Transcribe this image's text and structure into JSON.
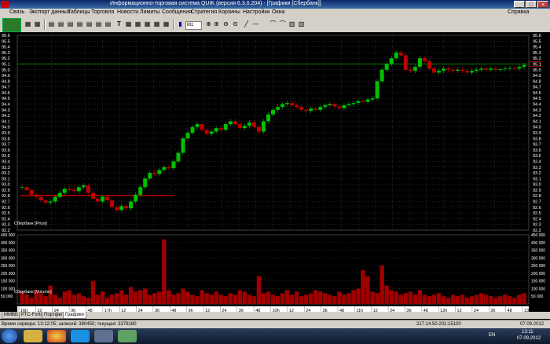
{
  "window": {
    "title": "Информационно-торговая система QUIK (версия 6.3.0.204) - [Графики [Сбербанк]]"
  },
  "menu": [
    "Связь",
    "Экспорт данных",
    "Таблицы",
    "Торговля",
    "Новости",
    "Лимиты",
    "Сообщения",
    "Стратегия",
    "Корзины",
    "Настройки",
    "Окна"
  ],
  "help_label": "Справка",
  "toolbar": {
    "interval": "M1"
  },
  "price_axis": [
    "95.6",
    "95.5",
    "95.4",
    "95.3",
    "95.2",
    "95.1",
    "95.0",
    "94.9",
    "94.8",
    "94.7",
    "94.6",
    "94.5",
    "94.4",
    "94.3",
    "94.2",
    "94.1",
    "94.0",
    "93.9",
    "93.8",
    "93.7",
    "93.6",
    "93.5",
    "93.4",
    "93.3",
    "93.2",
    "93.1",
    "93.0",
    "92.9",
    "92.8",
    "92.7",
    "92.6",
    "92.5",
    "92.4",
    "92.3",
    "92.2"
  ],
  "price_marker": "95.1",
  "price_legend": "Сбербанк [Price]",
  "volume_axis": [
    "450 000",
    "400 000",
    "350 000",
    "300 000",
    "250 000",
    "200 000",
    "150 000",
    "100 000",
    "50 000"
  ],
  "volume_legend": "Сбербанк [Volume]",
  "time_axis": [
    "16h",
    "12",
    "24",
    "36",
    "48",
    "17h",
    "12",
    "24",
    "36",
    "48",
    "9h",
    "12",
    "24",
    "36",
    "48",
    "10h",
    "12",
    "24",
    "36",
    "48",
    "11h",
    "12",
    "24",
    "36",
    "48",
    "12h",
    "12",
    "24",
    "36",
    "48",
    "13h"
  ],
  "time_axis_sub": "7",
  "tabs": [
    "ММВБ",
    "РТС-Forts",
    "Портфель",
    "Графики"
  ],
  "status": {
    "left": "Время сервера: 13:12:05; записей: 380450; текущая: 3378180",
    "connection": "217.14.50.201:15100",
    "date": "07.09.2012"
  },
  "taskbar": {
    "lang": "EN",
    "time": "13:11",
    "date": "07.09.2012"
  },
  "colors": {
    "bg": "#000000",
    "candle_up": "#00c000",
    "candle_down": "#c00000",
    "grid": "#808080",
    "marker_line": "#00a000"
  },
  "chart_data": {
    "type": "candlestick",
    "price_series": [
      92.95,
      92.9,
      92.82,
      92.78,
      92.72,
      92.68,
      92.7,
      92.78,
      92.85,
      92.92,
      92.9,
      92.88,
      92.95,
      92.98,
      92.85,
      92.75,
      92.7,
      92.78,
      92.72,
      92.6,
      92.55,
      92.62,
      92.58,
      92.7,
      92.82,
      92.95,
      93.1,
      93.2,
      93.18,
      93.25,
      93.3,
      93.28,
      93.4,
      93.55,
      93.8,
      93.9,
      94.0,
      94.05,
      93.95,
      93.88,
      93.92,
      93.98,
      93.95,
      94.05,
      94.1,
      94.05,
      93.98,
      94.02,
      94.08,
      94.0,
      93.92,
      94.1,
      94.22,
      94.3,
      94.35,
      94.4,
      94.42,
      94.38,
      94.35,
      94.3,
      94.28,
      94.32,
      94.3,
      94.35,
      94.38,
      94.4,
      94.36,
      94.33,
      94.38,
      94.4,
      94.42,
      94.45,
      94.44,
      94.48,
      94.5,
      94.8,
      95.0,
      95.1,
      95.2,
      95.3,
      95.25,
      95.0,
      94.98,
      95.05,
      95.2,
      95.15,
      95.02,
      94.95,
      94.98,
      95.02,
      95.0,
      94.98,
      95.0,
      94.98,
      94.95,
      94.98,
      95.0,
      95.02,
      95.0,
      95.02,
      95.0,
      95.01,
      95.02,
      95.03,
      95.02,
      95.05,
      95.08
    ],
    "volume_series": [
      80,
      60,
      40,
      90,
      70,
      50,
      120,
      60,
      40,
      80,
      90,
      60,
      70,
      50,
      40,
      150,
      60,
      80,
      40,
      60,
      70,
      90,
      60,
      110,
      80,
      90,
      100,
      60,
      70,
      80,
      420,
      90,
      60,
      70,
      100,
      80,
      60,
      50,
      90,
      70,
      60,
      80,
      60,
      50,
      70,
      60,
      90,
      80,
      60,
      50,
      180,
      70,
      80,
      60,
      50,
      70,
      90,
      60,
      80,
      50,
      60,
      70,
      90,
      80,
      70,
      60,
      50,
      80,
      60,
      70,
      90,
      100,
      220,
      180,
      80,
      70,
      250,
      120,
      90,
      80,
      60,
      70,
      80,
      60,
      90,
      60,
      50,
      60,
      70,
      50,
      40,
      60,
      50,
      60,
      40,
      50,
      60,
      70,
      60,
      50,
      40,
      50,
      60,
      50,
      40,
      60,
      70
    ],
    "ylim": [
      92.2,
      95.6
    ],
    "vol_ylim": [
      0,
      450000
    ]
  }
}
